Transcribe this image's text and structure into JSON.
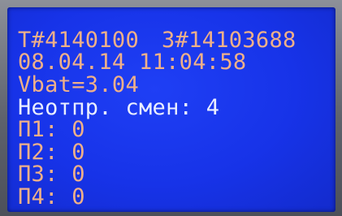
{
  "display": {
    "terminal_id": "T#4140100",
    "serial_id": "3#14103688",
    "date": "08.04.14",
    "time": "11:04:58",
    "battery": "Vbat=3.04",
    "unsent_shifts": "Неотпр. смен: 4",
    "counters": [
      {
        "label": "П1:",
        "value": "0"
      },
      {
        "label": "П2:",
        "value": "0"
      },
      {
        "label": "П3:",
        "value": "0"
      },
      {
        "label": "П4:",
        "value": "0"
      }
    ]
  },
  "colors": {
    "screen": "#1a3af0",
    "text_primary": "#efb089",
    "text_highlight": "#eaeeff"
  }
}
